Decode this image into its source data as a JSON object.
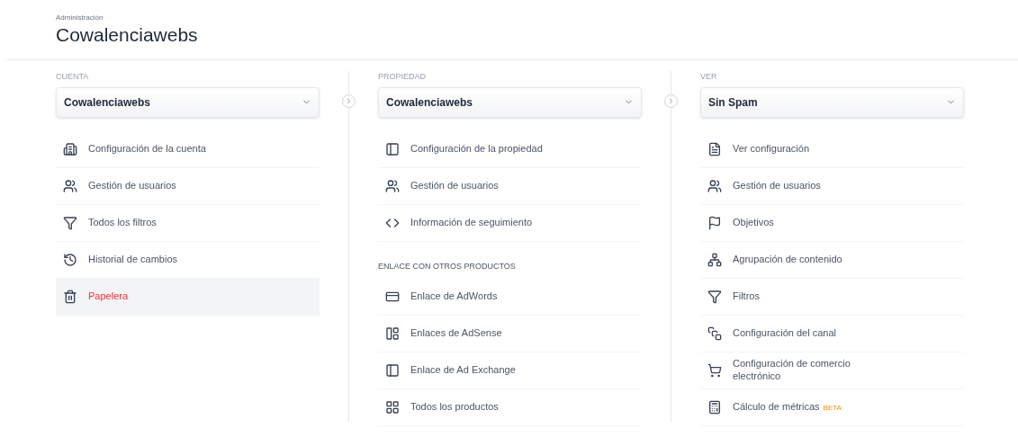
{
  "header": {
    "breadcrumb": "Administración",
    "title": "Cowalenciawebs"
  },
  "columns": [
    {
      "label": "CUENTA",
      "selector": "Cowalenciawebs",
      "items": [
        {
          "kind": "item",
          "label": "Configuración de la cuenta",
          "selected": false
        },
        {
          "kind": "item",
          "label": "Gestión de usuarios",
          "selected": false
        },
        {
          "kind": "item",
          "label": "Todos los filtros",
          "selected": false
        },
        {
          "kind": "item",
          "label": "Historial de cambios",
          "selected": false
        },
        {
          "kind": "item",
          "label": "Papelera",
          "selected": true
        }
      ]
    },
    {
      "label": "PROPIEDAD",
      "selector": "Cowalenciawebs",
      "items": [
        {
          "kind": "item",
          "label": "Configuración de la propiedad",
          "selected": false
        },
        {
          "kind": "item",
          "label": "Gestión de usuarios",
          "selected": false
        },
        {
          "kind": "item",
          "label": "Información de seguimiento",
          "selected": false
        },
        {
          "kind": "heading",
          "label": "ENLACE CON OTROS PRODUCTOS"
        },
        {
          "kind": "item",
          "label": "Enlace de AdWords",
          "selected": false
        },
        {
          "kind": "item",
          "label": "Enlaces de AdSense",
          "selected": false
        },
        {
          "kind": "item",
          "label": "Enlace de Ad Exchange",
          "selected": false
        },
        {
          "kind": "item",
          "label": "Todos los productos",
          "selected": false
        }
      ]
    },
    {
      "label": "VER",
      "selector": "Sin Spam",
      "items": [
        {
          "kind": "item",
          "label": "Ver configuración",
          "selected": false
        },
        {
          "kind": "item",
          "label": "Gestión de usuarios",
          "selected": false
        },
        {
          "kind": "item",
          "label": "Objetivos",
          "selected": false
        },
        {
          "kind": "item",
          "label": "Agrupación de contenido",
          "selected": false
        },
        {
          "kind": "item",
          "label": "Filtros",
          "selected": false
        },
        {
          "kind": "item",
          "label": "Configuración del canal",
          "selected": false
        },
        {
          "kind": "item",
          "label": "Configuración de comercio electrónico",
          "selected": false
        },
        {
          "kind": "item",
          "label": "Cálculo de métricas",
          "badge": "BETA",
          "selected": false
        }
      ]
    }
  ]
}
